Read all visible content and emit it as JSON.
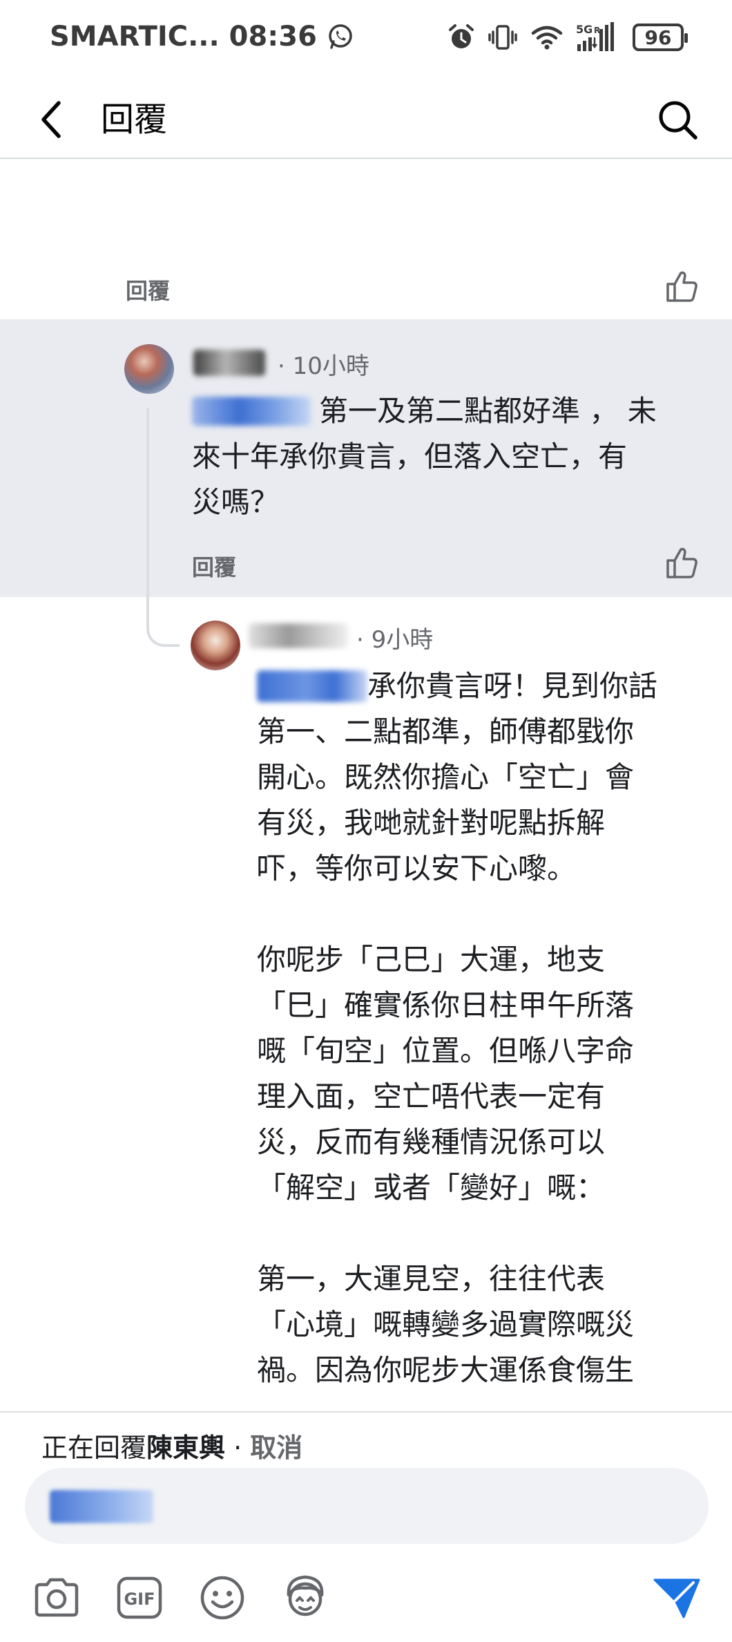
{
  "status_bar": {
    "carrier_time": "SMARTIC... 08:36",
    "network": "5G",
    "battery": "96"
  },
  "header": {
    "title": "回覆"
  },
  "top_comment": {
    "reply_label": "回覆"
  },
  "comment_1": {
    "time": "· 10小時",
    "text": "第一及第二點都好準 ， 未來十年承你貴言，但落入空亡，有災嗎？",
    "line1": "第一及第二點都好準 ， 未",
    "line2": "來十年承你貴言，但落入空亡，有",
    "line3": "災嗎？",
    "reply_label": "回覆"
  },
  "comment_2": {
    "time": "· 9小時",
    "lines": [
      "承你貴言呀！見到你話",
      "第一、二點都準，師傅都戥你",
      "開心。既然你擔心「空亡」會",
      "有災，我哋就針對呢點拆解",
      "吓，等你可以安下心嚟。",
      "",
      "你呢步「己巳」大運，地支",
      "「巳」確實係你日柱甲午所落",
      "嘅「旬空」位置。但喺八字命",
      "理入面，空亡唔代表一定有",
      "災，反而有幾種情況係可以",
      "「解空」或者「變好」嘅：",
      "",
      "第一，大運見空，往往代表",
      "「心境」嘅轉變多過實際嘅災",
      "禍。因為你呢步大運係食傷生"
    ]
  },
  "composer": {
    "replying_prefix": "正在回覆",
    "replying_name": "陳東輿",
    "separator": " · ",
    "cancel": "取消"
  },
  "colors": {
    "highlight_bg": "#e9ebf0",
    "send_blue": "#1b74e4",
    "muted_text": "#65676b"
  }
}
